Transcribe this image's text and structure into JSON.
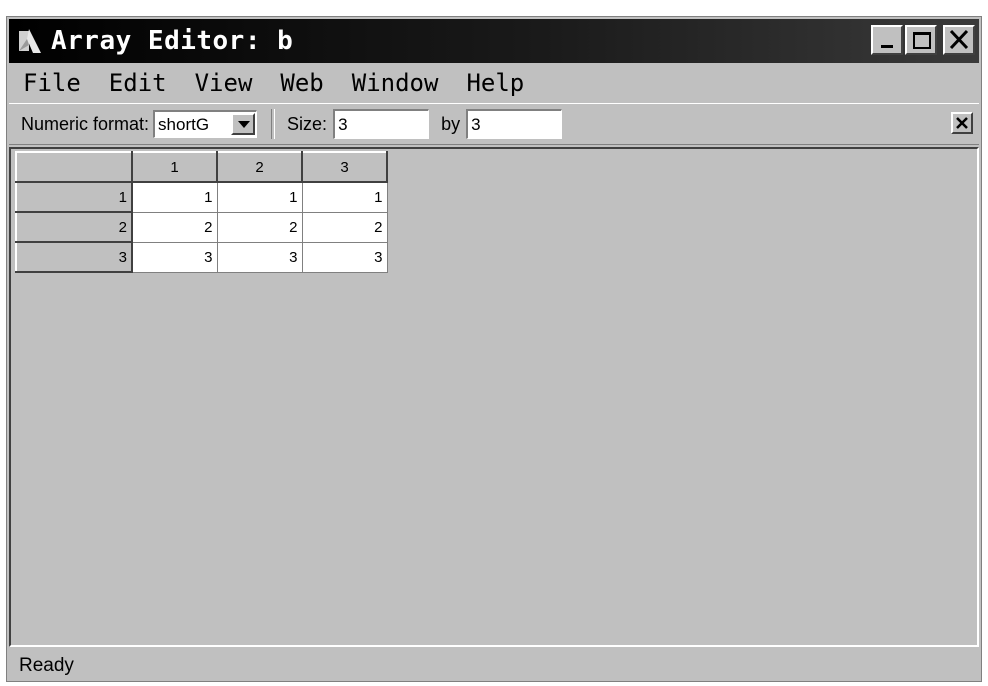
{
  "window": {
    "title": "Array Editor: b"
  },
  "menu": {
    "items": [
      "File",
      "Edit",
      "View",
      "Web",
      "Window",
      "Help"
    ]
  },
  "toolbar": {
    "numeric_format_label": "Numeric format:",
    "numeric_format_value": "shortG",
    "size_label": "Size:",
    "rows": "3",
    "by_label": "by",
    "cols": "3"
  },
  "grid": {
    "column_headers": [
      "1",
      "2",
      "3"
    ],
    "row_headers": [
      "1",
      "2",
      "3"
    ],
    "rows": [
      [
        "1",
        "1",
        "1"
      ],
      [
        "2",
        "2",
        "2"
      ],
      [
        "3",
        "3",
        "3"
      ]
    ]
  },
  "status": {
    "text": "Ready"
  },
  "icons": [
    "app-icon",
    "minimize-icon",
    "maximize-icon",
    "close-icon",
    "chevron-down-icon",
    "close-toolbar-icon"
  ]
}
